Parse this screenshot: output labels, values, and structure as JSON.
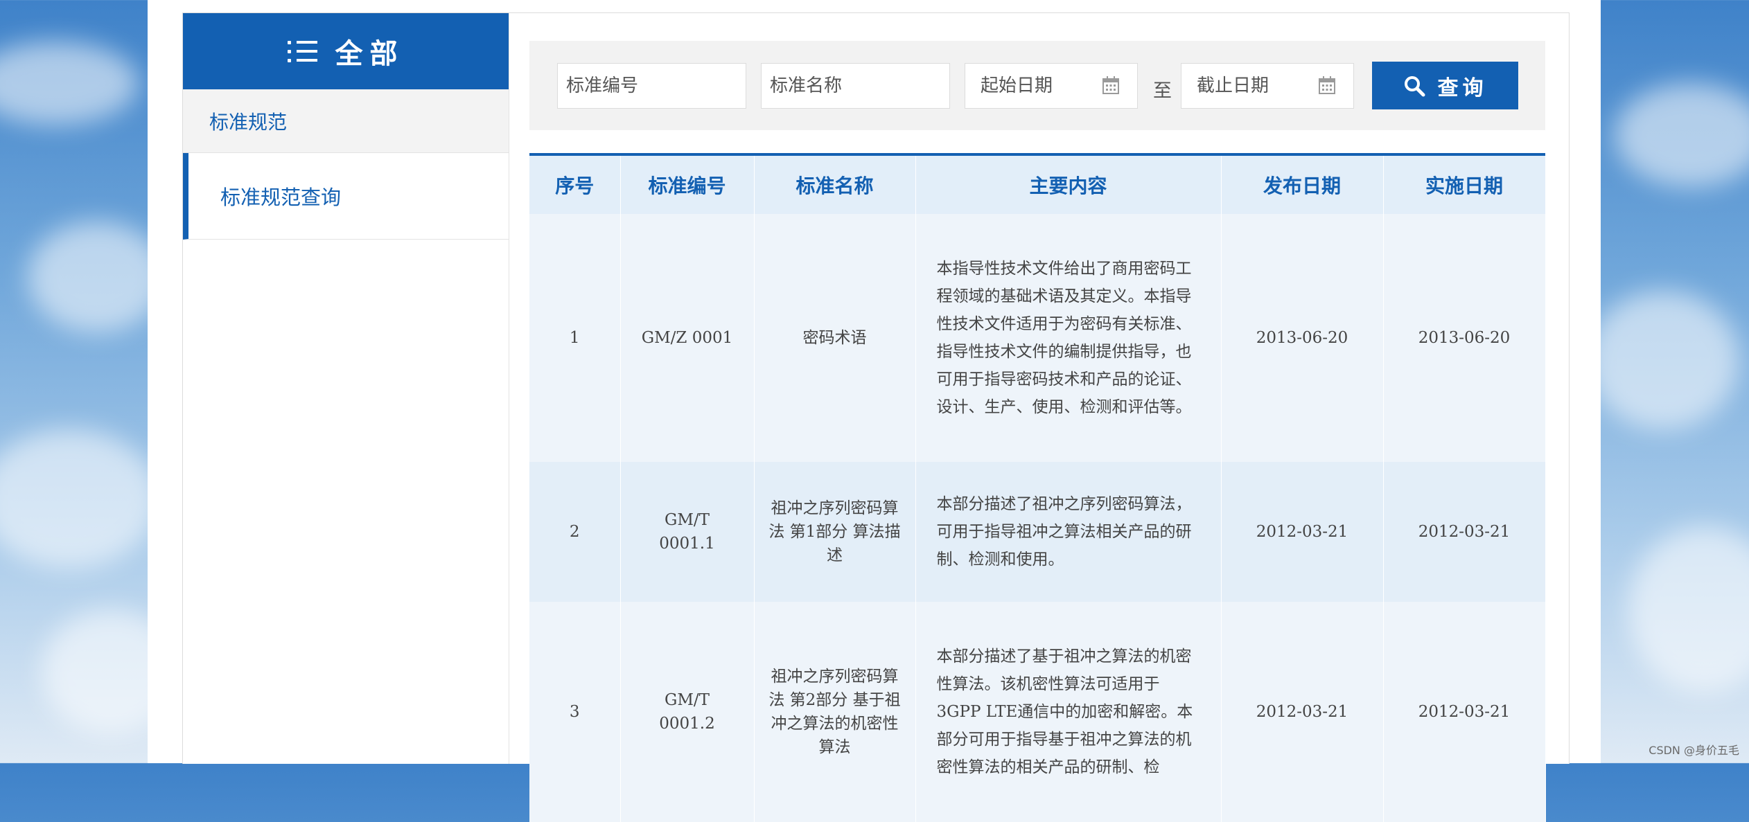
{
  "sidebar": {
    "title": "全部",
    "category": "标准规范",
    "items": [
      {
        "label": "标准规范查询"
      }
    ]
  },
  "search": {
    "code_placeholder": "标准编号",
    "name_placeholder": "标准名称",
    "start_date_placeholder": "起始日期",
    "to_label": "至",
    "end_date_placeholder": "截止日期",
    "button_label": "查询"
  },
  "table": {
    "columns": [
      "序号",
      "标准编号",
      "标准名称",
      "主要内容",
      "发布日期",
      "实施日期"
    ],
    "rows": [
      {
        "index": "1",
        "code": "GM/Z 0001",
        "name": "密码术语",
        "content": "本指导性技术文件给出了商用密码工程领域的基础术语及其定义。本指导性技术文件适用于为密码有关标准、指导性技术文件的编制提供指导，也可用于指导密码技术和产品的论证、设计、生产、使用、检测和评估等。",
        "publish_date": "2013-06-20",
        "effective_date": "2013-06-20"
      },
      {
        "index": "2",
        "code": "GM/T 0001.1",
        "name": "祖冲之序列密码算法 第1部分 算法描述",
        "content": "本部分描述了祖冲之序列密码算法，可用于指导祖冲之算法相关产品的研制、检测和使用。",
        "publish_date": "2012-03-21",
        "effective_date": "2012-03-21"
      },
      {
        "index": "3",
        "code": "GM/T 0001.2",
        "name": "祖冲之序列密码算法 第2部分 基于祖冲之算法的机密性算法",
        "content": "本部分描述了基于祖冲之算法的机密性算法。该机密性算法可适用于3GPP LTE通信中的加密和解密。本部分可用于指导基于祖冲之算法的机密性算法的相关产品的研制、检",
        "publish_date": "2012-03-21",
        "effective_date": "2012-03-21"
      }
    ]
  },
  "watermark": "CSDN @身价五毛",
  "colors": {
    "primary": "#1360b2",
    "header_bg": "#e2eef9",
    "row_odd": "#eef4fa",
    "row_even": "#e3eef8"
  }
}
